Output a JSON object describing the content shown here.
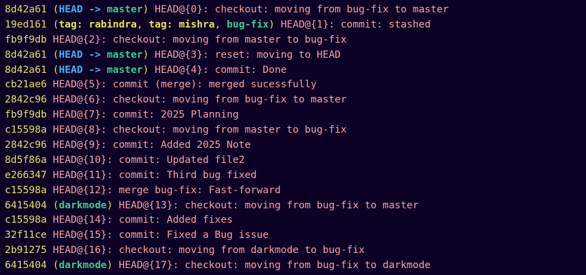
{
  "colors": {
    "background": "#0c0024",
    "hash": "#e6e25a",
    "head": "#3fb3f6",
    "branch": "#30d08e",
    "tag": "#e6e25a",
    "message": "#f5a3a9"
  },
  "lines": [
    {
      "hash": "8d42a61",
      "decor": [
        {
          "type": "head",
          "text": "HEAD"
        },
        {
          "type": "arrow",
          "text": " -> "
        },
        {
          "type": "branch",
          "text": "master"
        }
      ],
      "ref": "HEAD@{0}",
      "msg": ": checkout: moving from bug-fix to master"
    },
    {
      "hash": "19ed161",
      "decor": [
        {
          "type": "tag",
          "text": "tag: rabindra"
        },
        {
          "type": "sep",
          "text": ", "
        },
        {
          "type": "tag",
          "text": "tag: mishra"
        },
        {
          "type": "sep",
          "text": ", "
        },
        {
          "type": "branch",
          "text": "bug-fix"
        }
      ],
      "ref": "HEAD@{1}",
      "msg": ": commit: stashed"
    },
    {
      "hash": "fb9f9db",
      "decor": [],
      "ref": "HEAD@{2}",
      "msg": ": checkout: moving from master to bug-fix"
    },
    {
      "hash": "8d42a61",
      "decor": [
        {
          "type": "head",
          "text": "HEAD"
        },
        {
          "type": "arrow",
          "text": " -> "
        },
        {
          "type": "branch",
          "text": "master"
        }
      ],
      "ref": "HEAD@{3}",
      "msg": ": reset: moving to HEAD"
    },
    {
      "hash": "8d42a61",
      "decor": [
        {
          "type": "head",
          "text": "HEAD"
        },
        {
          "type": "arrow",
          "text": " -> "
        },
        {
          "type": "branch",
          "text": "master"
        }
      ],
      "ref": "HEAD@{4}",
      "msg": ": commit: Done"
    },
    {
      "hash": "cb21ae6",
      "decor": [],
      "ref": "HEAD@{5}",
      "msg": ": commit (merge): merged sucessfully"
    },
    {
      "hash": "2842c96",
      "decor": [],
      "ref": "HEAD@{6}",
      "msg": ": checkout: moving from bug-fix to master"
    },
    {
      "hash": "fb9f9db",
      "decor": [],
      "ref": "HEAD@{7}",
      "msg": ": commit: 2025 Planning"
    },
    {
      "hash": "c15598a",
      "decor": [],
      "ref": "HEAD@{8}",
      "msg": ": checkout: moving from master to bug-fix"
    },
    {
      "hash": "2842c96",
      "decor": [],
      "ref": "HEAD@{9}",
      "msg": ": commit: Added 2025 Note"
    },
    {
      "hash": "8d5f86a",
      "decor": [],
      "ref": "HEAD@{10}",
      "msg": ": commit: Updated file2"
    },
    {
      "hash": "e266347",
      "decor": [],
      "ref": "HEAD@{11}",
      "msg": ": commit: Third bug fixed"
    },
    {
      "hash": "c15598a",
      "decor": [],
      "ref": "HEAD@{12}",
      "msg": ": merge bug-fix: Fast-forward"
    },
    {
      "hash": "6415404",
      "decor": [
        {
          "type": "branch",
          "text": "darkmode"
        }
      ],
      "ref": "HEAD@{13}",
      "msg": ": checkout: moving from bug-fix to master"
    },
    {
      "hash": "c15598a",
      "decor": [],
      "ref": "HEAD@{14}",
      "msg": ": commit: Added fixes"
    },
    {
      "hash": "32f11ce",
      "decor": [],
      "ref": "HEAD@{15}",
      "msg": ": commit: Fixed a Bug issue"
    },
    {
      "hash": "2b91275",
      "decor": [],
      "ref": "HEAD@{16}",
      "msg": ": checkout: moving from darkmode to bug-fix"
    },
    {
      "hash": "6415404",
      "decor": [
        {
          "type": "branch",
          "text": "darkmode"
        }
      ],
      "ref": "HEAD@{17}",
      "msg": ": checkout: moving from bug-fix to darkmode"
    }
  ]
}
